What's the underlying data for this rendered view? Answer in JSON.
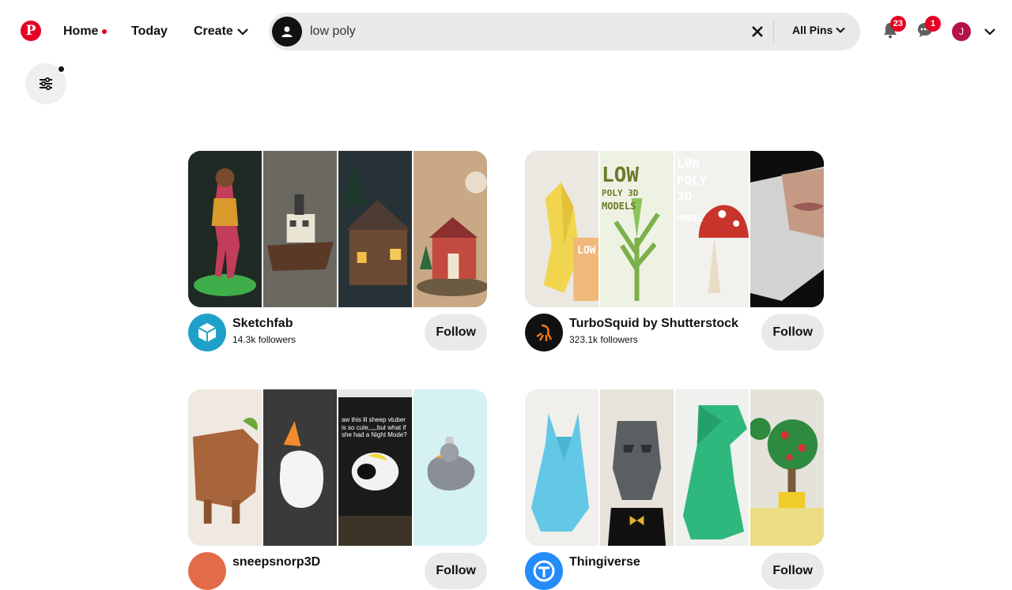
{
  "header": {
    "logo_letter": "P",
    "nav": {
      "home": "Home",
      "today": "Today",
      "create": "Create"
    },
    "search": {
      "value": "low poly",
      "filter_label": "All Pins"
    },
    "notifications_count": "23",
    "messages_count": "1",
    "user_initial": "J"
  },
  "colors": {
    "brand": "#e60023",
    "avatar": "#b3124a",
    "search_bg": "#e9e9e9"
  },
  "icons": [
    "pinterest-logo-icon",
    "user-icon",
    "close-icon",
    "chevron-down-icon",
    "bell-icon",
    "chat-icon",
    "filters-icon"
  ],
  "boards": [
    {
      "name": "Sketchfab",
      "followers": "14.3k followers",
      "follow_label": "Follow"
    },
    {
      "name": "TurboSquid by Shutterstock",
      "followers": "323.1k followers",
      "follow_label": "Follow"
    },
    {
      "name": "sneepsnorp3D",
      "followers": "",
      "follow_label": "Follow"
    },
    {
      "name": "Thingiverse",
      "followers": "",
      "follow_label": "Follow"
    }
  ],
  "turbosquid_art": {
    "line1": "LOW",
    "line2": "POLY 3D",
    "line3": "MODELS",
    "small1": "LOW",
    "small2": "POLY",
    "small3": "3D",
    "small4": "MODEL",
    "tile4_1": "LOW",
    "tile4_2": "POLY",
    "tile4_3": "3D",
    "tile4_4": "MODELS"
  },
  "sneep_caption": "aw this lil sheep vtuber is so cute,,,,,but what if she had a Night Mode?"
}
